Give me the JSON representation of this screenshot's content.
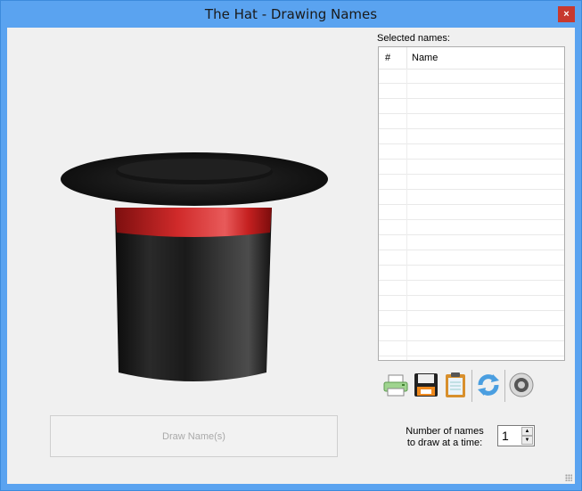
{
  "window": {
    "title": "The Hat - Drawing Names",
    "close_glyph": "×"
  },
  "hat": {
    "icon": "top-hat-image",
    "band_color": "#c81d1d",
    "body_color": "#1c1c1c"
  },
  "draw_button": {
    "label": "Draw Name(s)",
    "enabled": false
  },
  "selected": {
    "label": "Selected names:",
    "columns": [
      "#",
      "Name"
    ],
    "rows": []
  },
  "toolbar": {
    "items": [
      "printer-icon",
      "save-icon",
      "clipboard-icon",
      "refresh-icon",
      "sound-icon"
    ]
  },
  "count": {
    "label_line1": "Number of names",
    "label_line2": "to draw at a time:",
    "value": "1"
  }
}
